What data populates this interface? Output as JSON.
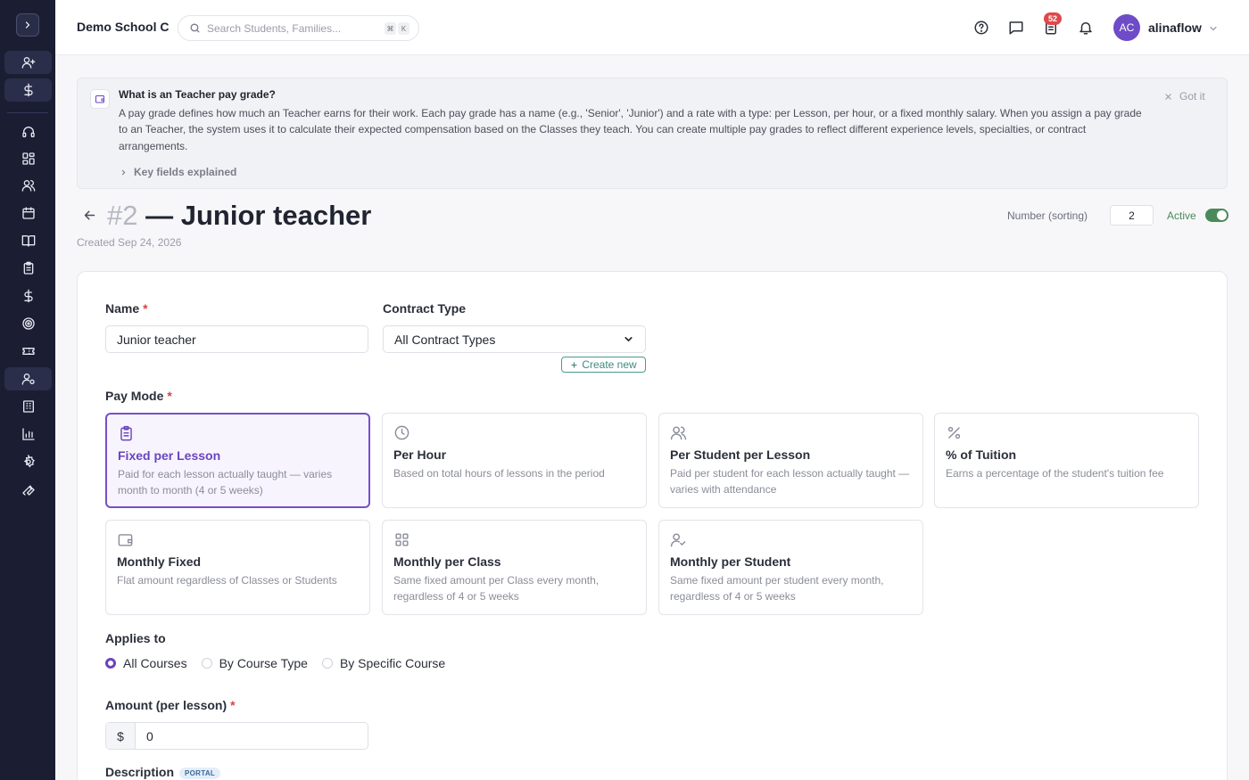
{
  "header": {
    "school_name": "Demo School C",
    "search_placeholder": "Search Students, Families...",
    "shortcut_keys": [
      "⌘",
      "K"
    ],
    "notification_count": "52",
    "user_initials": "AC",
    "user_name": "alinaflow"
  },
  "banner": {
    "title": "What is an Teacher pay grade?",
    "text": "A pay grade defines how much an Teacher earns for their work. Each pay grade has a name (e.g., 'Senior', 'Junior') and a rate with a type: per Lesson, per hour, or a fixed monthly salary. When you assign a pay grade to an Teacher, the system uses it to calculate their expected compensation based on the Classes they teach. You can create multiple pay grades to reflect different experience levels, specialties, or contract arrangements.",
    "dismiss_label": "Got it",
    "expand_label": "Key fields explained"
  },
  "page": {
    "number": "#2",
    "title": "— Junior teacher",
    "created": "Created Sep 24, 2026",
    "sort_label": "Number (sorting)",
    "sort_value": "2",
    "active_label": "Active"
  },
  "form": {
    "name_label": "Name",
    "name_value": "Junior teacher",
    "contract_label": "Contract Type",
    "contract_value": "All Contract Types",
    "create_new_label": "Create new",
    "pay_mode_label": "Pay Mode",
    "pay_modes": [
      {
        "title": "Fixed per Lesson",
        "desc": "Paid for each lesson actually taught — varies month to month (4 or 5 weeks)"
      },
      {
        "title": "Per Hour",
        "desc": "Based on total hours of lessons in the period"
      },
      {
        "title": "Per Student per Lesson",
        "desc": "Paid per student for each lesson actually taught — varies with attendance"
      },
      {
        "title": "% of Tuition",
        "desc": "Earns a percentage of the student's tuition fee"
      },
      {
        "title": "Monthly Fixed",
        "desc": "Flat amount regardless of Classes or Students"
      },
      {
        "title": "Monthly per Class",
        "desc": "Same fixed amount per Class every month, regardless of 4 or 5 weeks"
      },
      {
        "title": "Monthly per Student",
        "desc": "Same fixed amount per student every month, regardless of 4 or 5 weeks"
      }
    ],
    "applies_label": "Applies to",
    "applies_options": [
      "All Courses",
      "By Course Type",
      "By Specific Course"
    ],
    "amount_label": "Amount (per lesson)",
    "currency": "$",
    "amount_value": "0",
    "description_label": "Description",
    "portal_badge": "PORTAL",
    "required_mark": "*"
  },
  "colors": {
    "sidebar_bg": "#1b1d33",
    "accent_purple": "#6a44be",
    "active_green": "#4a8a5a",
    "badge_red": "#e0484b"
  }
}
